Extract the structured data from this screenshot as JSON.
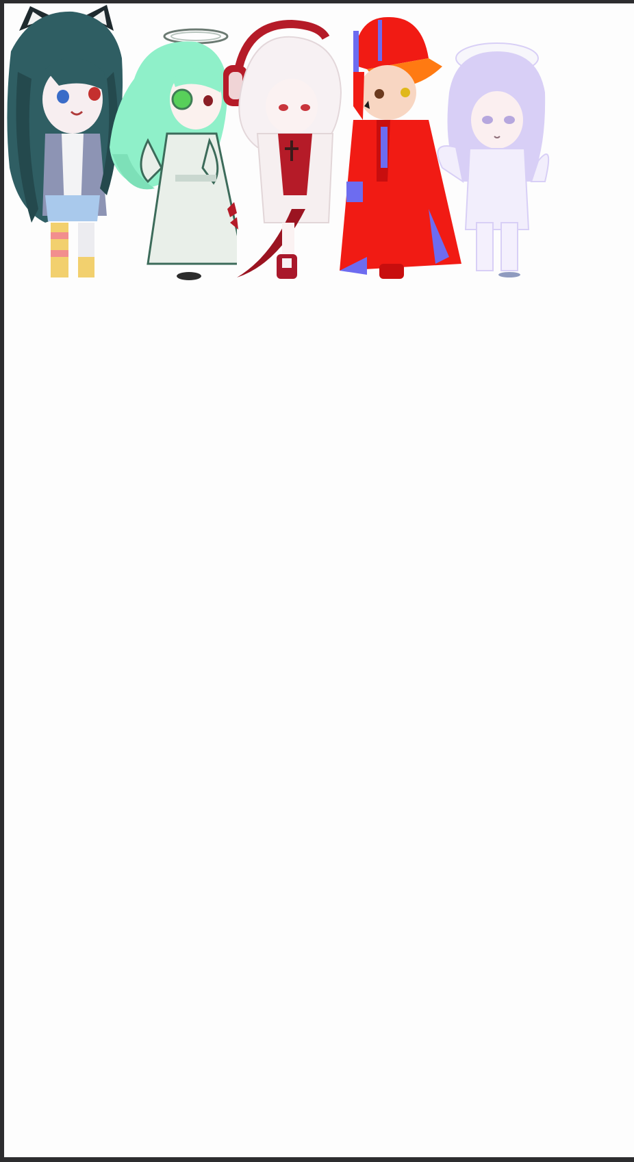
{
  "canvas": {
    "background": "#fdfdfd",
    "frame_color": "#2d2d2f"
  },
  "characters": [
    {
      "name": "dark-teal-wolf-eared-girl",
      "icon": "character-figure-icon",
      "hair": "#2f5e63",
      "accent": "#8d94b4"
    },
    {
      "name": "mint-haired-angel",
      "icon": "character-figure-icon",
      "hair": "#8ff0c9",
      "accent": "#e9efe9"
    },
    {
      "name": "white-haired-headphones-character",
      "icon": "character-figure-icon",
      "hair": "#f7f1f3",
      "accent": "#b51b28"
    },
    {
      "name": "red-cap-boy",
      "icon": "character-figure-icon",
      "hair": "#f11b14",
      "accent": "#ff7a12"
    },
    {
      "name": "lavender-haired-girl",
      "icon": "character-figure-icon",
      "hair": "#d8cff6",
      "accent": "#f2eefc"
    }
  ]
}
